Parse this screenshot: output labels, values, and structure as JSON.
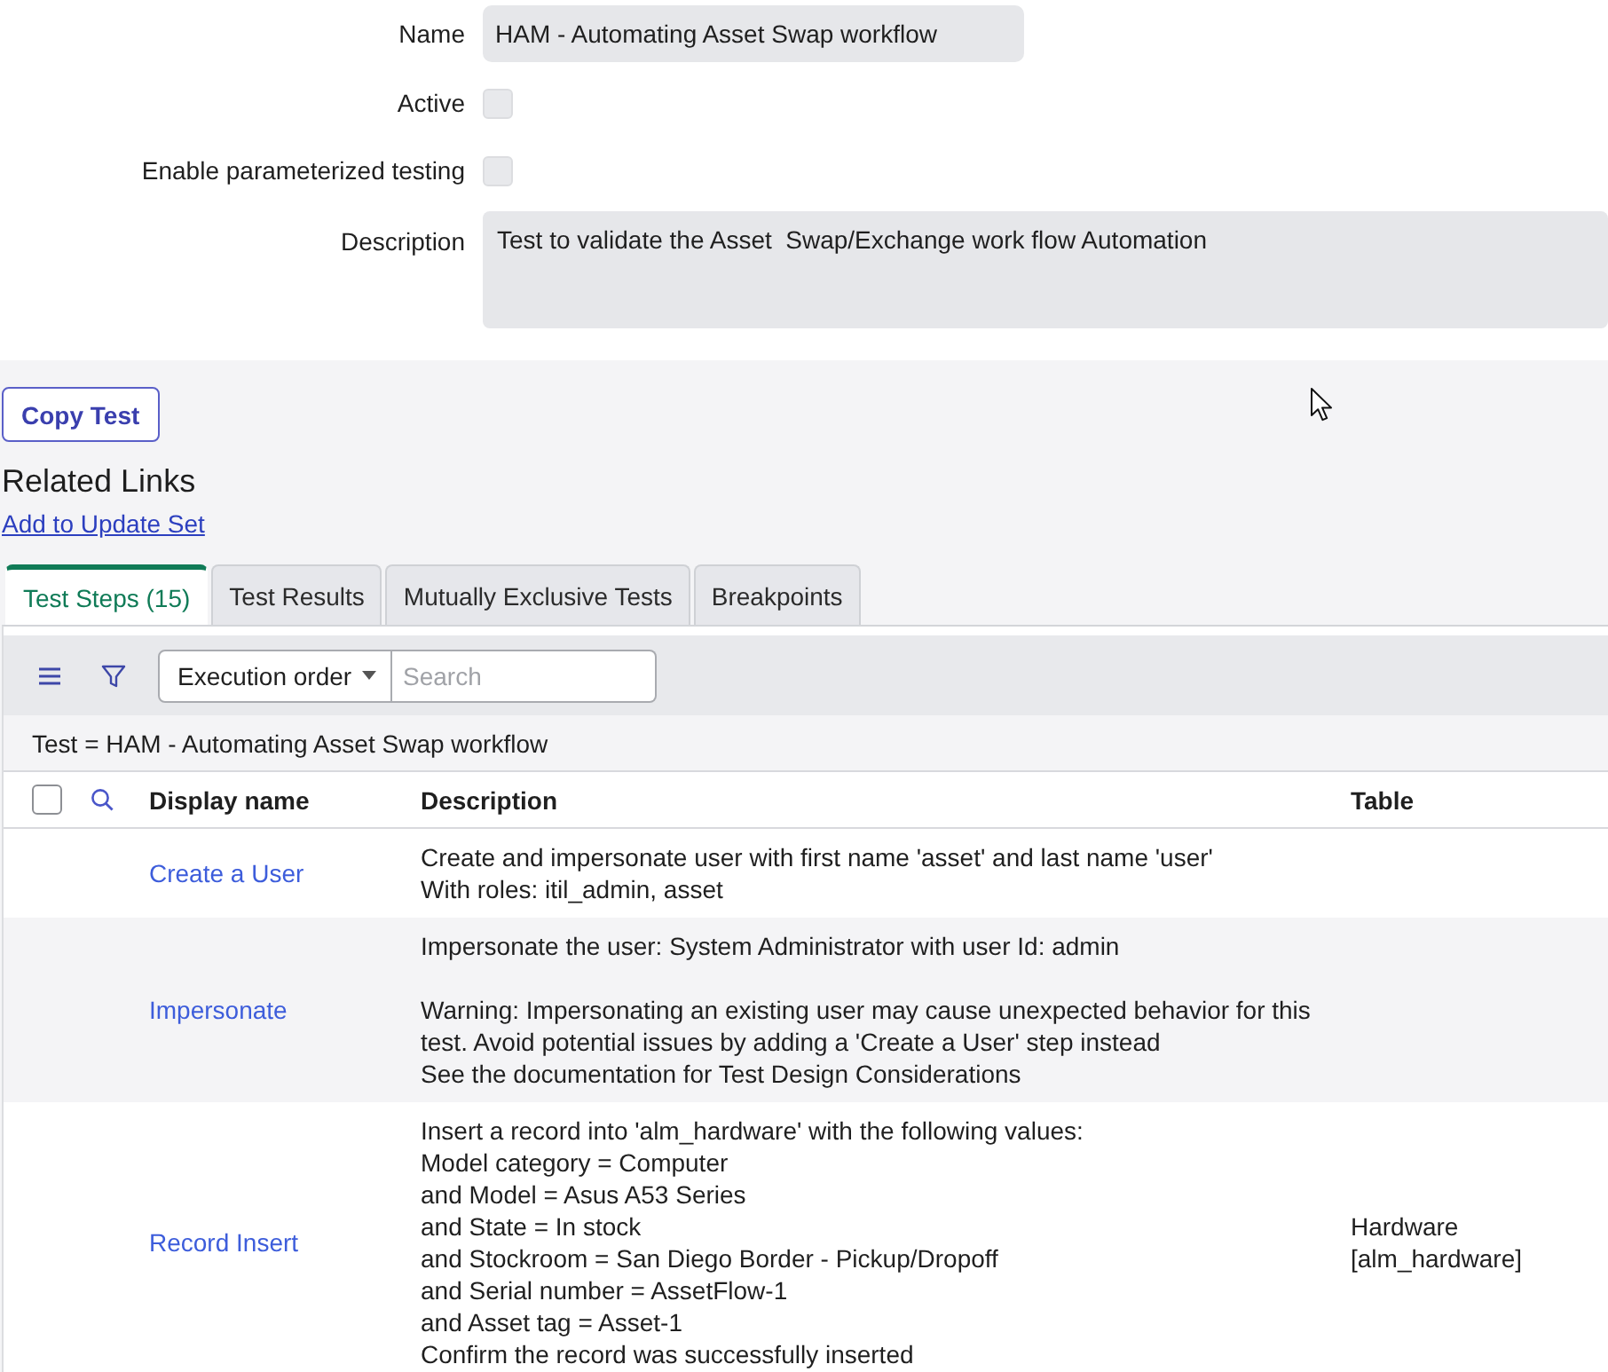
{
  "form": {
    "fields": [
      {
        "kind": "text",
        "label": "Name",
        "value": "HAM - Automating Asset Swap workflow"
      },
      {
        "kind": "checkbox",
        "label": "Active",
        "checked": false
      },
      {
        "kind": "checkbox",
        "label": "Enable parameterized testing",
        "checked": false
      },
      {
        "kind": "textarea",
        "label": "Description",
        "value": "Test to validate the Asset  Swap/Exchange work flow Automation"
      }
    ]
  },
  "actions": {
    "buttons": [
      "Copy Test"
    ]
  },
  "related_links": {
    "title": "Related Links",
    "links": [
      "Add to Update Set"
    ]
  },
  "tabs": [
    {
      "label": "Test Steps (15)",
      "selected": true
    },
    {
      "label": "Test Results",
      "selected": false
    },
    {
      "label": "Mutually Exclusive Tests",
      "selected": false
    },
    {
      "label": "Breakpoints",
      "selected": false
    }
  ],
  "list": {
    "toolbar": {
      "sort_select": "Execution order",
      "search": {
        "placeholder": "Search"
      }
    },
    "breadcrumb": "Test = HAM - Automating Asset Swap workflow",
    "select_all": {
      "checked": false
    },
    "columns": [
      "Display name",
      "Description",
      "Table"
    ],
    "rows": [
      {
        "display_name": "Create a User",
        "description": "Create and impersonate user with first name 'asset' and last name 'user'\nWith roles: itil_admin, asset"
      },
      {
        "display_name": "Impersonate",
        "description": "Impersonate the user: System Administrator with user Id: admin\n\nWarning: Impersonating an existing user may cause unexpected behavior for this\ntest. Avoid potential issues by adding a 'Create a User' step instead\nSee the documentation for Test Design Considerations"
      },
      {
        "display_name": "Record Insert",
        "description": "Insert a record into 'alm_hardware' with the following values:\nModel category = Computer\nand Model = Asus A53 Series\nand State = In stock\nand Stockroom = San Diego Border - Pickup/Dropoff\nand Serial number = AssetFlow-1\nand Asset tag = Asset-1\nConfirm the record was successfully inserted",
        "table": "Hardware\n[alm_hardware]"
      }
    ]
  }
}
